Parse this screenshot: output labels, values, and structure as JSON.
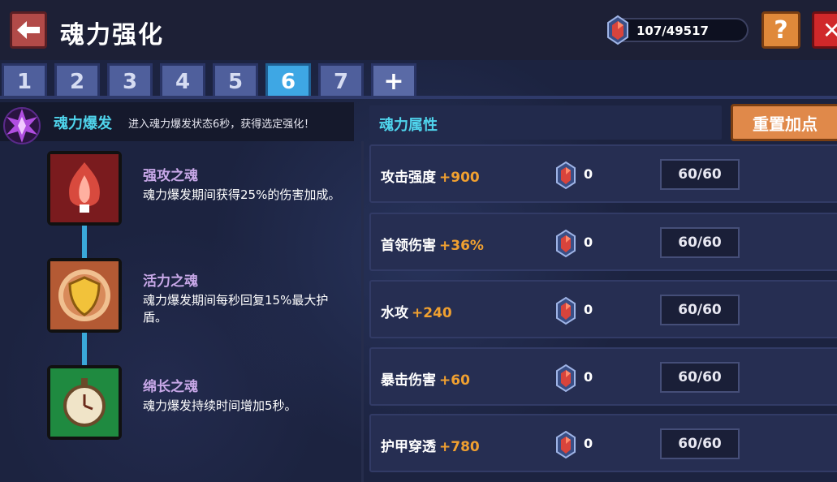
{
  "header": {
    "title": "魂力强化",
    "currency_value": "107/49517",
    "help_label": "?",
    "close_label": "✕"
  },
  "tabs": [
    "1",
    "2",
    "3",
    "4",
    "5",
    "6",
    "7",
    "+"
  ],
  "active_tab": "6",
  "burst": {
    "title": "魂力爆发",
    "description": "进入魂力爆发状态6秒，获得选定强化！"
  },
  "skills": [
    {
      "name": "强攻之魂",
      "description": "魂力爆发期间获得25%的伤害加成。",
      "icon": "red-flame-icon"
    },
    {
      "name": "活力之魂",
      "description": "魂力爆发期间每秒回复15%最大护盾。",
      "icon": "gold-shield-icon"
    },
    {
      "name": "绵长之魂",
      "description": "魂力爆发持续时间增加5秒。",
      "icon": "green-clock-icon"
    }
  ],
  "attributes_panel": {
    "title": "魂力属性",
    "reset_label": "重置加点"
  },
  "attributes": [
    {
      "name": "攻击强度",
      "bonus": "+900",
      "count": "0",
      "level": "60/60"
    },
    {
      "name": "首领伤害",
      "bonus": "+36%",
      "count": "0",
      "level": "60/60"
    },
    {
      "name": "水攻",
      "bonus": "+240",
      "count": "0",
      "level": "60/60"
    },
    {
      "name": "暴击伤害",
      "bonus": "+60",
      "count": "0",
      "level": "60/60"
    },
    {
      "name": "护甲穿透",
      "bonus": "+780",
      "count": "0",
      "level": "60/60"
    }
  ],
  "colors": {
    "accent_cyan": "#4fd4ec",
    "bonus_orange": "#f0a030",
    "active_tab": "#3ea7e4",
    "reset_button": "#e0894a",
    "close_button": "#d0282a"
  }
}
